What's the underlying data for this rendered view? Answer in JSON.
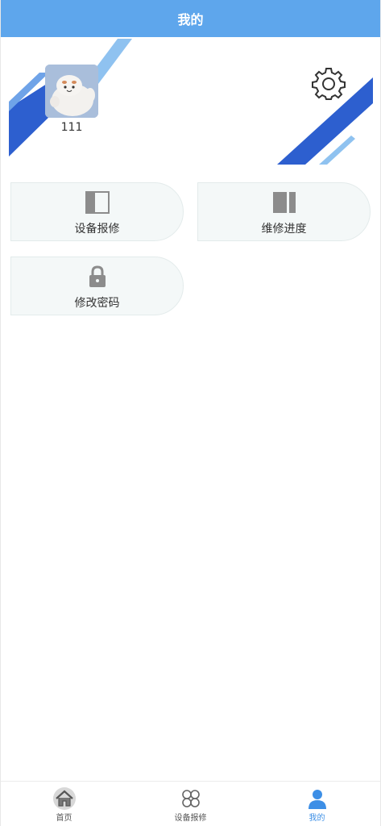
{
  "header": {
    "title": "我的"
  },
  "profile": {
    "username": "111"
  },
  "menu": {
    "items": [
      {
        "label": "设备报修",
        "icon": "panel-left-icon"
      },
      {
        "label": "维修进度",
        "icon": "panel-right-icon"
      },
      {
        "label": "修改密码",
        "icon": "lock-icon"
      }
    ]
  },
  "tabbar": {
    "items": [
      {
        "label": "首页",
        "icon": "home-icon",
        "active": false
      },
      {
        "label": "设备报修",
        "icon": "grid-circles-icon",
        "active": false
      },
      {
        "label": "我的",
        "icon": "user-icon",
        "active": true
      }
    ]
  },
  "colors": {
    "header_bg": "#5ea6ec",
    "accent": "#3d8fe6",
    "stripe_dark": "#2d5fcf",
    "stripe_light": "#7fb7ee",
    "card_bg": "#f4f8f8"
  }
}
